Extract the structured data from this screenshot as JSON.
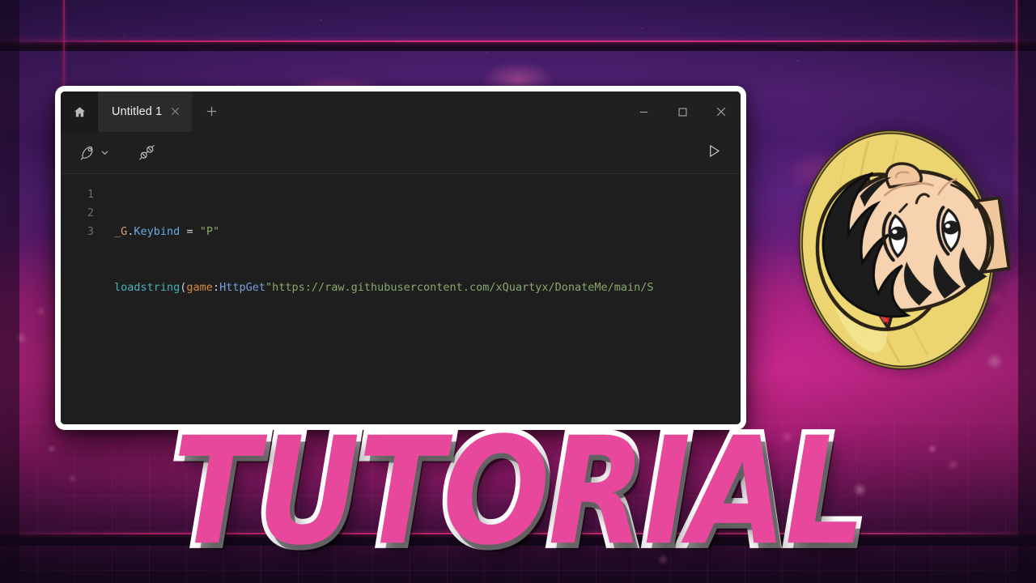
{
  "window": {
    "home_icon": "home-icon",
    "tabs": [
      {
        "label": "Untitled 1",
        "close_icon": "close-icon",
        "active": true
      }
    ],
    "new_tab_label": "+",
    "controls": {
      "minimize_icon": "minimize-icon",
      "maximize_icon": "maximize-icon",
      "close_icon": "close-icon"
    }
  },
  "toolbar": {
    "execute_icon": "rocket-icon",
    "execute_dropdown_icon": "chevron-down-icon",
    "inject_icon": "plug-connect-icon",
    "run_icon": "play-icon"
  },
  "editor": {
    "line_numbers": [
      "1",
      "2",
      "3"
    ],
    "lines": [
      {
        "number": "1",
        "tokens": [
          {
            "text": "_G",
            "type": "global"
          },
          {
            "text": ".",
            "type": "punct"
          },
          {
            "text": "Keybind",
            "type": "prop"
          },
          {
            "text": " = ",
            "type": "op"
          },
          {
            "text": "\"P\"",
            "type": "string"
          }
        ]
      },
      {
        "number": "2",
        "tokens": [
          {
            "text": "loadstring",
            "type": "func"
          },
          {
            "text": "(",
            "type": "punct"
          },
          {
            "text": "game",
            "type": "keyword"
          },
          {
            "text": ":",
            "type": "punct"
          },
          {
            "text": "HttpGet",
            "type": "method"
          },
          {
            "text": "\"https://raw.githubusercontent.com/xQuartyx/DonateMe/main/S",
            "type": "string"
          }
        ]
      },
      {
        "number": "3",
        "tokens": []
      }
    ],
    "full_text_line_1": "_G.Keybind = \"P\"",
    "full_text_line_2": "loadstring(game:HttpGet\"https://raw.githubusercontent.com/xQuartyx/DonateMe/main/S"
  },
  "overlay": {
    "title": "TUTORIAL"
  },
  "character": {
    "name": "straw-hat-anime-character",
    "hat_color": "#f2dd7e",
    "hat_band_color": "#d62b2b",
    "hair_color": "#1a1a1a",
    "skin_color": "#f6d2ae"
  },
  "colors": {
    "accent_pink": "#e8489b",
    "outline_white": "#ffffff",
    "editor_bg": "#1e1e1e",
    "titlebar_bg": "#202020",
    "active_tab_bg": "#2b2b2b",
    "toolbar_bg": "#1f1f1f",
    "background_purple": "#5c2380",
    "background_magenta": "#b92283"
  }
}
